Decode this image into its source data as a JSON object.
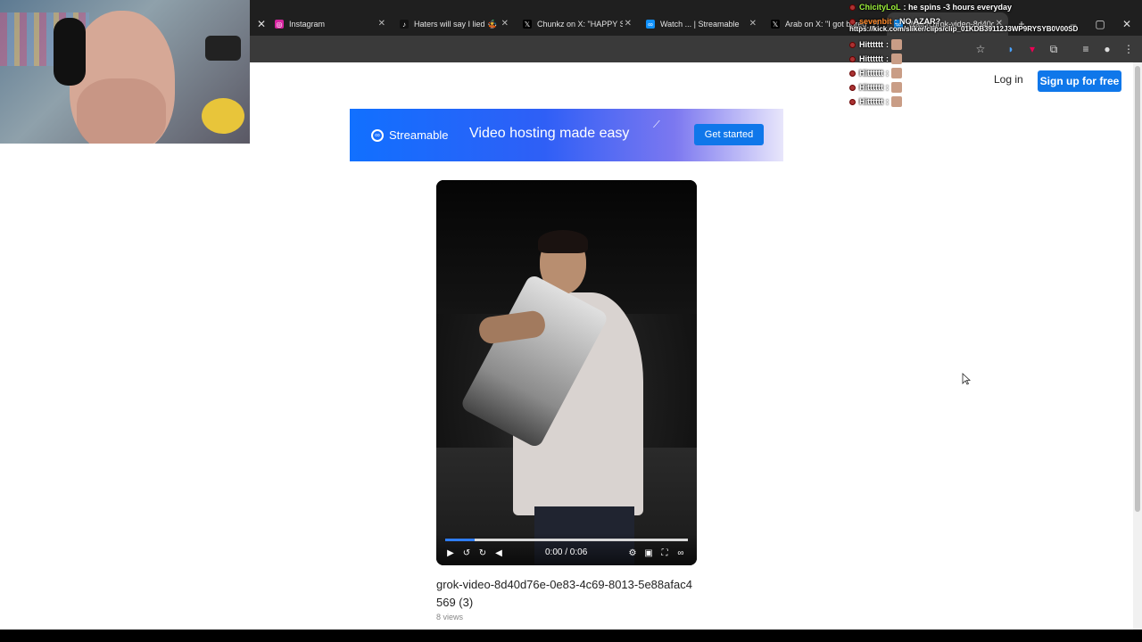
{
  "browser": {
    "tabs": [
      {
        "title": "Instagram",
        "icon": "instagram-icon"
      },
      {
        "title": "Haters will say I lied 🤹 😂",
        "icon": "tiktok-icon"
      },
      {
        "title": "Chunkz on X: \"HAPPY SO",
        "icon": "x-icon"
      },
      {
        "title": "Watch ... | Streamable",
        "icon": "streamable-icon"
      },
      {
        "title": "Arab on X: \"I got bored",
        "icon": "x-icon"
      },
      {
        "title": "Watch grok-video-8d40c",
        "icon": "streamable-icon"
      }
    ]
  },
  "header": {
    "login": "Log in",
    "signup": "Sign up for free"
  },
  "banner": {
    "brand": "Streamable",
    "tagline": "Video hosting made easy",
    "cta": "Get started"
  },
  "video": {
    "time": "0:00 / 0:06",
    "progress": 0.12,
    "title": "grok-video-8d40d76e-0e83-4c69-8013-5e88afac4569 (3)",
    "views": "8 views"
  },
  "chat": {
    "messages": [
      {
        "user": "ChicityLoL",
        "user_color": "#9cf03a",
        "text": ": he spins -3 hours everyday",
        "emote": false
      },
      {
        "user": "sevenbit",
        "user_color": "#ff8a2b",
        "text": ": NO AZAR?",
        "emote": false
      },
      {
        "user": "Hitttttt",
        "user_color": "#ffffff",
        "text": ":",
        "emote": true
      },
      {
        "user": "Hitttttt",
        "user_color": "#ffffff",
        "text": ":",
        "emote": true
      },
      {
        "user": "Hitttttt",
        "user_color": "#ffffff",
        "text": ":",
        "emote": true
      },
      {
        "user": "Hitttttt",
        "user_color": "#ffffff",
        "text": ":",
        "emote": true
      },
      {
        "user": "Hitttttt",
        "user_color": "#ffffff",
        "text": ":",
        "emote": true
      }
    ],
    "url": "https://kick.com/sliker/clips/clip_01KDB39112J3WP9RYSYB0V00SD"
  },
  "colors": {
    "accent": "#0f77ea",
    "progress": "#2f7df6"
  }
}
